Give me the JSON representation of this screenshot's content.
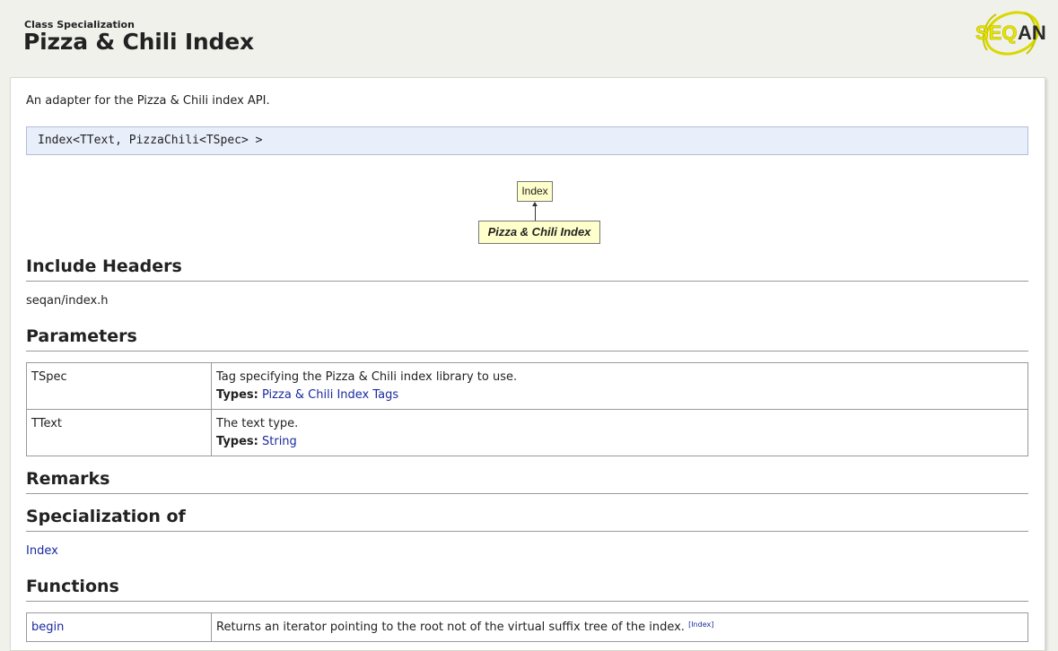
{
  "header": {
    "kind": "Class Specialization",
    "title": "Pizza & Chili Index",
    "logo_text": "SEQAN"
  },
  "intro": "An adapter for the Pizza & Chili index API.",
  "signature": "Index<TText, PizzaChili<TSpec> >",
  "diagram": {
    "parent": "Index",
    "self": "Pizza & Chili Index"
  },
  "include_headers": {
    "heading": "Include Headers",
    "header": "seqan/index.h"
  },
  "parameters": {
    "heading": "Parameters",
    "rows": [
      {
        "name": "TSpec",
        "desc": "Tag specifying the Pizza & Chili index library to use.",
        "types_label": "Types:",
        "types_link": "Pizza & Chili Index Tags"
      },
      {
        "name": "TText",
        "desc": "The text type.",
        "types_label": "Types:",
        "types_link": "String"
      }
    ]
  },
  "remarks": {
    "heading": "Remarks"
  },
  "specialization_of": {
    "heading": "Specialization of",
    "link": "Index"
  },
  "functions": {
    "heading": "Functions",
    "rows": [
      {
        "name": "begin",
        "desc": "Returns an iterator pointing to the root not of the virtual suffix tree of the index.",
        "ref": "[Index]"
      }
    ]
  },
  "colors": {
    "page_bg": "#f1f1ec",
    "signature_bg": "#e8eefa",
    "diagram_box_bg": "#ffffcc",
    "link": "#1a2aa0",
    "logo_yellow": "#e6e600"
  }
}
